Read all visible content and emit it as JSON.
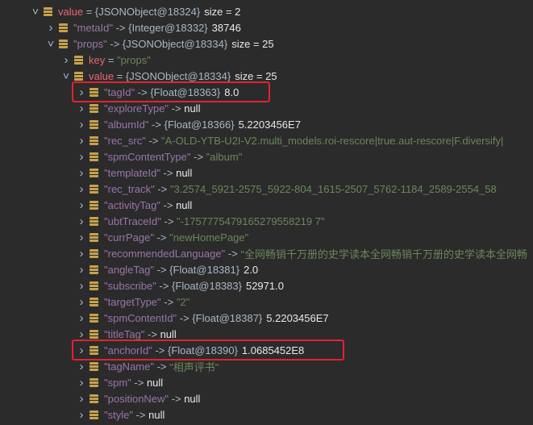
{
  "rows": [
    {
      "indent": 0,
      "expanded": true,
      "name": "value",
      "kind": "plain",
      "rel": " = ",
      "type": "{JSONObject@18324}",
      "val": "size = 2",
      "vkind": "size"
    },
    {
      "indent": 1,
      "expanded": false,
      "name": "\"metaId\"",
      "kind": "quoted",
      "rel": " -> ",
      "type": "{Integer@18332}",
      "val": "38746",
      "vkind": "num"
    },
    {
      "indent": 1,
      "expanded": true,
      "name": "\"props\"",
      "kind": "quoted",
      "rel": " -> ",
      "type": "{JSONObject@18334}",
      "val": "size = 25",
      "vkind": "size"
    },
    {
      "indent": 2,
      "expanded": false,
      "name": "key",
      "kind": "plain",
      "rel": " = ",
      "type": "",
      "val": "\"props\"",
      "vkind": "str"
    },
    {
      "indent": 2,
      "expanded": true,
      "name": "value",
      "kind": "plain",
      "rel": " = ",
      "type": "{JSONObject@18334}",
      "val": "size = 25",
      "vkind": "size"
    },
    {
      "indent": 3,
      "expanded": false,
      "name": "\"tagId\"",
      "kind": "quoted",
      "rel": " -> ",
      "type": "{Float@18363}",
      "val": "8.0",
      "vkind": "num"
    },
    {
      "indent": 3,
      "expanded": false,
      "name": "\"exploreType\"",
      "kind": "quoted",
      "rel": " -> ",
      "type": "",
      "val": "null",
      "vkind": "kw"
    },
    {
      "indent": 3,
      "expanded": false,
      "name": "\"albumId\"",
      "kind": "quoted",
      "rel": " -> ",
      "type": "{Float@18366}",
      "val": "5.2203456E7",
      "vkind": "num"
    },
    {
      "indent": 3,
      "expanded": false,
      "name": "\"rec_src\"",
      "kind": "quoted",
      "rel": " -> ",
      "type": "",
      "val": "\"A-OLD-YTB-U2I-V2.multi_models.roi-rescore|true.aut-rescore|F.diversify|",
      "vkind": "str"
    },
    {
      "indent": 3,
      "expanded": false,
      "name": "\"spmContentType\"",
      "kind": "quoted",
      "rel": " -> ",
      "type": "",
      "val": "\"album\"",
      "vkind": "str"
    },
    {
      "indent": 3,
      "expanded": false,
      "name": "\"templateId\"",
      "kind": "quoted",
      "rel": " -> ",
      "type": "",
      "val": "null",
      "vkind": "kw"
    },
    {
      "indent": 3,
      "expanded": false,
      "name": "\"rec_track\"",
      "kind": "quoted",
      "rel": " -> ",
      "type": "",
      "val": "\"3.2574_5921-2575_5922-804_1615-2507_5762-1184_2589-2554_58",
      "vkind": "str"
    },
    {
      "indent": 3,
      "expanded": false,
      "name": "\"activityTag\"",
      "kind": "quoted",
      "rel": " -> ",
      "type": "",
      "val": "null",
      "vkind": "kw"
    },
    {
      "indent": 3,
      "expanded": false,
      "name": "\"ubtTraceId\"",
      "kind": "quoted",
      "rel": " -> ",
      "type": "",
      "val": "\"-1757775479165279558219 7\"",
      "vkind": "str"
    },
    {
      "indent": 3,
      "expanded": false,
      "name": "\"currPage\"",
      "kind": "quoted",
      "rel": " -> ",
      "type": "",
      "val": "\"newHomePage\"",
      "vkind": "str"
    },
    {
      "indent": 3,
      "expanded": false,
      "name": "\"recommendedLanguage\"",
      "kind": "quoted",
      "rel": " -> ",
      "type": "",
      "val": "\"全网畅销千万册的史学读本全网畅销千万册的史学读本全网畅",
      "vkind": "str"
    },
    {
      "indent": 3,
      "expanded": false,
      "name": "\"angleTag\"",
      "kind": "quoted",
      "rel": " -> ",
      "type": "{Float@18381}",
      "val": "2.0",
      "vkind": "num"
    },
    {
      "indent": 3,
      "expanded": false,
      "name": "\"subscribe\"",
      "kind": "quoted",
      "rel": " -> ",
      "type": "{Float@18383}",
      "val": "52971.0",
      "vkind": "num"
    },
    {
      "indent": 3,
      "expanded": false,
      "name": "\"targetType\"",
      "kind": "quoted",
      "rel": " -> ",
      "type": "",
      "val": "\"2\"",
      "vkind": "str"
    },
    {
      "indent": 3,
      "expanded": false,
      "name": "\"spmContentId\"",
      "kind": "quoted",
      "rel": " -> ",
      "type": "{Float@18387}",
      "val": "5.2203456E7",
      "vkind": "num"
    },
    {
      "indent": 3,
      "expanded": false,
      "name": "\"titleTag\"",
      "kind": "quoted",
      "rel": " -> ",
      "type": "",
      "val": "null",
      "vkind": "kw"
    },
    {
      "indent": 3,
      "expanded": false,
      "name": "\"anchorId\"",
      "kind": "quoted",
      "rel": " -> ",
      "type": "{Float@18390}",
      "val": "1.0685452E8",
      "vkind": "num"
    },
    {
      "indent": 3,
      "expanded": false,
      "name": "\"tagName\"",
      "kind": "quoted",
      "rel": " -> ",
      "type": "",
      "val": "\"相声评书\"",
      "vkind": "str"
    },
    {
      "indent": 3,
      "expanded": false,
      "name": "\"spm\"",
      "kind": "quoted",
      "rel": " -> ",
      "type": "",
      "val": "null",
      "vkind": "kw"
    },
    {
      "indent": 3,
      "expanded": false,
      "name": "\"positionNew\"",
      "kind": "quoted",
      "rel": " -> ",
      "type": "",
      "val": "null",
      "vkind": "kw"
    },
    {
      "indent": 3,
      "expanded": false,
      "name": "\"style\"",
      "kind": "quoted",
      "rel": " -> ",
      "type": "",
      "val": "null",
      "vkind": "kw"
    }
  ],
  "highlights": [
    5,
    21
  ],
  "colors": {
    "highlight": "#e0242f",
    "field_icon": "#c9a24a",
    "string": "#6a8759",
    "quoted_name": "#9876aa",
    "plain_name": "#e46876"
  }
}
